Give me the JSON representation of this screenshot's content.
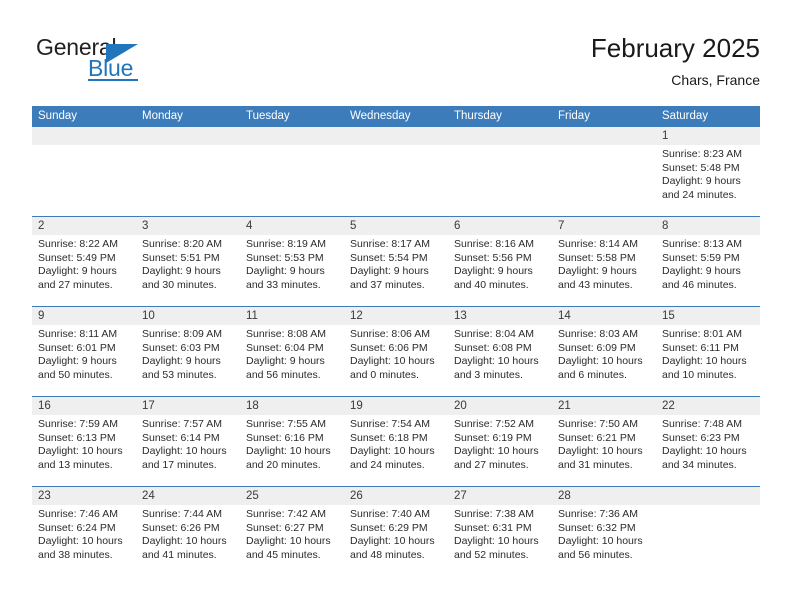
{
  "brand": {
    "name_part1": "General",
    "name_part2": "Blue"
  },
  "header": {
    "title": "February 2025",
    "location": "Chars, France"
  },
  "calendar": {
    "day_headers": [
      "Sunday",
      "Monday",
      "Tuesday",
      "Wednesday",
      "Thursday",
      "Friday",
      "Saturday"
    ],
    "colors": {
      "header_blue": "#3c7cba",
      "daynum_band": "#efefef",
      "brand_blue": "#2175bc",
      "text": "#2b2b2b"
    },
    "weeks": [
      [
        {
          "day": "",
          "sunrise": "",
          "sunset": "",
          "daylight_line1": "",
          "daylight_line2": ""
        },
        {
          "day": "",
          "sunrise": "",
          "sunset": "",
          "daylight_line1": "",
          "daylight_line2": ""
        },
        {
          "day": "",
          "sunrise": "",
          "sunset": "",
          "daylight_line1": "",
          "daylight_line2": ""
        },
        {
          "day": "",
          "sunrise": "",
          "sunset": "",
          "daylight_line1": "",
          "daylight_line2": ""
        },
        {
          "day": "",
          "sunrise": "",
          "sunset": "",
          "daylight_line1": "",
          "daylight_line2": ""
        },
        {
          "day": "",
          "sunrise": "",
          "sunset": "",
          "daylight_line1": "",
          "daylight_line2": ""
        },
        {
          "day": "1",
          "sunrise": "Sunrise: 8:23 AM",
          "sunset": "Sunset: 5:48 PM",
          "daylight_line1": "Daylight: 9 hours",
          "daylight_line2": "and 24 minutes."
        }
      ],
      [
        {
          "day": "2",
          "sunrise": "Sunrise: 8:22 AM",
          "sunset": "Sunset: 5:49 PM",
          "daylight_line1": "Daylight: 9 hours",
          "daylight_line2": "and 27 minutes."
        },
        {
          "day": "3",
          "sunrise": "Sunrise: 8:20 AM",
          "sunset": "Sunset: 5:51 PM",
          "daylight_line1": "Daylight: 9 hours",
          "daylight_line2": "and 30 minutes."
        },
        {
          "day": "4",
          "sunrise": "Sunrise: 8:19 AM",
          "sunset": "Sunset: 5:53 PM",
          "daylight_line1": "Daylight: 9 hours",
          "daylight_line2": "and 33 minutes."
        },
        {
          "day": "5",
          "sunrise": "Sunrise: 8:17 AM",
          "sunset": "Sunset: 5:54 PM",
          "daylight_line1": "Daylight: 9 hours",
          "daylight_line2": "and 37 minutes."
        },
        {
          "day": "6",
          "sunrise": "Sunrise: 8:16 AM",
          "sunset": "Sunset: 5:56 PM",
          "daylight_line1": "Daylight: 9 hours",
          "daylight_line2": "and 40 minutes."
        },
        {
          "day": "7",
          "sunrise": "Sunrise: 8:14 AM",
          "sunset": "Sunset: 5:58 PM",
          "daylight_line1": "Daylight: 9 hours",
          "daylight_line2": "and 43 minutes."
        },
        {
          "day": "8",
          "sunrise": "Sunrise: 8:13 AM",
          "sunset": "Sunset: 5:59 PM",
          "daylight_line1": "Daylight: 9 hours",
          "daylight_line2": "and 46 minutes."
        }
      ],
      [
        {
          "day": "9",
          "sunrise": "Sunrise: 8:11 AM",
          "sunset": "Sunset: 6:01 PM",
          "daylight_line1": "Daylight: 9 hours",
          "daylight_line2": "and 50 minutes."
        },
        {
          "day": "10",
          "sunrise": "Sunrise: 8:09 AM",
          "sunset": "Sunset: 6:03 PM",
          "daylight_line1": "Daylight: 9 hours",
          "daylight_line2": "and 53 minutes."
        },
        {
          "day": "11",
          "sunrise": "Sunrise: 8:08 AM",
          "sunset": "Sunset: 6:04 PM",
          "daylight_line1": "Daylight: 9 hours",
          "daylight_line2": "and 56 minutes."
        },
        {
          "day": "12",
          "sunrise": "Sunrise: 8:06 AM",
          "sunset": "Sunset: 6:06 PM",
          "daylight_line1": "Daylight: 10 hours",
          "daylight_line2": "and 0 minutes."
        },
        {
          "day": "13",
          "sunrise": "Sunrise: 8:04 AM",
          "sunset": "Sunset: 6:08 PM",
          "daylight_line1": "Daylight: 10 hours",
          "daylight_line2": "and 3 minutes."
        },
        {
          "day": "14",
          "sunrise": "Sunrise: 8:03 AM",
          "sunset": "Sunset: 6:09 PM",
          "daylight_line1": "Daylight: 10 hours",
          "daylight_line2": "and 6 minutes."
        },
        {
          "day": "15",
          "sunrise": "Sunrise: 8:01 AM",
          "sunset": "Sunset: 6:11 PM",
          "daylight_line1": "Daylight: 10 hours",
          "daylight_line2": "and 10 minutes."
        }
      ],
      [
        {
          "day": "16",
          "sunrise": "Sunrise: 7:59 AM",
          "sunset": "Sunset: 6:13 PM",
          "daylight_line1": "Daylight: 10 hours",
          "daylight_line2": "and 13 minutes."
        },
        {
          "day": "17",
          "sunrise": "Sunrise: 7:57 AM",
          "sunset": "Sunset: 6:14 PM",
          "daylight_line1": "Daylight: 10 hours",
          "daylight_line2": "and 17 minutes."
        },
        {
          "day": "18",
          "sunrise": "Sunrise: 7:55 AM",
          "sunset": "Sunset: 6:16 PM",
          "daylight_line1": "Daylight: 10 hours",
          "daylight_line2": "and 20 minutes."
        },
        {
          "day": "19",
          "sunrise": "Sunrise: 7:54 AM",
          "sunset": "Sunset: 6:18 PM",
          "daylight_line1": "Daylight: 10 hours",
          "daylight_line2": "and 24 minutes."
        },
        {
          "day": "20",
          "sunrise": "Sunrise: 7:52 AM",
          "sunset": "Sunset: 6:19 PM",
          "daylight_line1": "Daylight: 10 hours",
          "daylight_line2": "and 27 minutes."
        },
        {
          "day": "21",
          "sunrise": "Sunrise: 7:50 AM",
          "sunset": "Sunset: 6:21 PM",
          "daylight_line1": "Daylight: 10 hours",
          "daylight_line2": "and 31 minutes."
        },
        {
          "day": "22",
          "sunrise": "Sunrise: 7:48 AM",
          "sunset": "Sunset: 6:23 PM",
          "daylight_line1": "Daylight: 10 hours",
          "daylight_line2": "and 34 minutes."
        }
      ],
      [
        {
          "day": "23",
          "sunrise": "Sunrise: 7:46 AM",
          "sunset": "Sunset: 6:24 PM",
          "daylight_line1": "Daylight: 10 hours",
          "daylight_line2": "and 38 minutes."
        },
        {
          "day": "24",
          "sunrise": "Sunrise: 7:44 AM",
          "sunset": "Sunset: 6:26 PM",
          "daylight_line1": "Daylight: 10 hours",
          "daylight_line2": "and 41 minutes."
        },
        {
          "day": "25",
          "sunrise": "Sunrise: 7:42 AM",
          "sunset": "Sunset: 6:27 PM",
          "daylight_line1": "Daylight: 10 hours",
          "daylight_line2": "and 45 minutes."
        },
        {
          "day": "26",
          "sunrise": "Sunrise: 7:40 AM",
          "sunset": "Sunset: 6:29 PM",
          "daylight_line1": "Daylight: 10 hours",
          "daylight_line2": "and 48 minutes."
        },
        {
          "day": "27",
          "sunrise": "Sunrise: 7:38 AM",
          "sunset": "Sunset: 6:31 PM",
          "daylight_line1": "Daylight: 10 hours",
          "daylight_line2": "and 52 minutes."
        },
        {
          "day": "28",
          "sunrise": "Sunrise: 7:36 AM",
          "sunset": "Sunset: 6:32 PM",
          "daylight_line1": "Daylight: 10 hours",
          "daylight_line2": "and 56 minutes."
        },
        {
          "day": "",
          "sunrise": "",
          "sunset": "",
          "daylight_line1": "",
          "daylight_line2": ""
        }
      ]
    ]
  }
}
